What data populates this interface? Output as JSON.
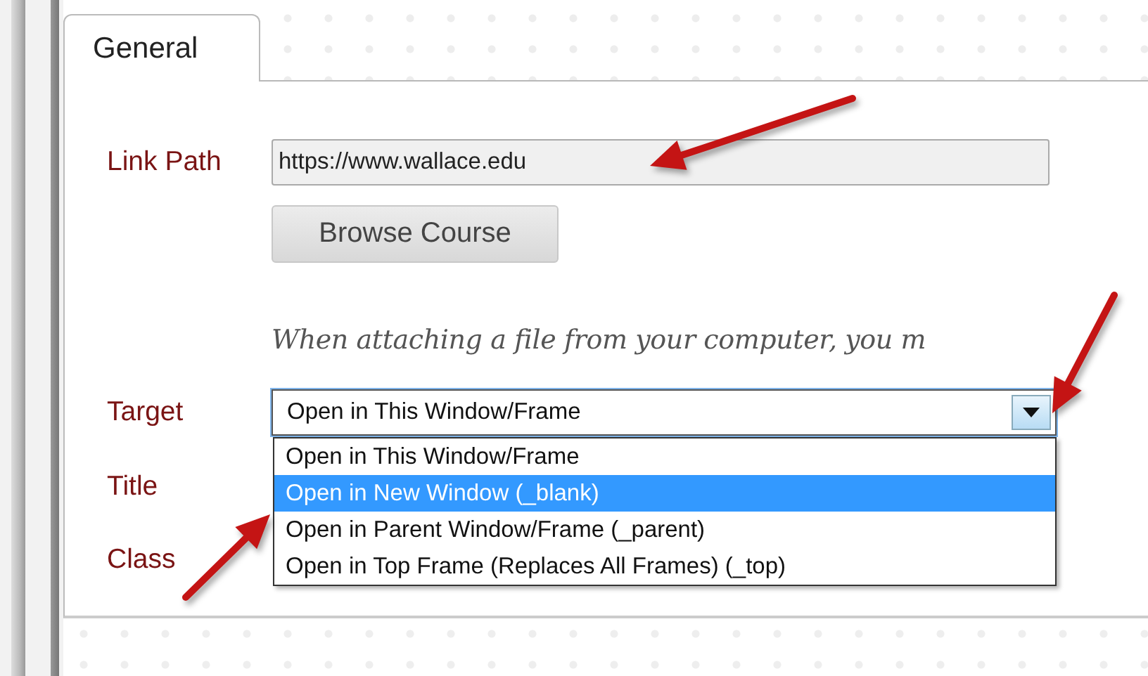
{
  "tabs": [
    {
      "label": "General",
      "selected": true
    }
  ],
  "link_path": {
    "label": "Link Path",
    "value": "https://www.wallace.edu"
  },
  "browse_button": "Browse Course",
  "note": "When attaching a file from your computer, you m",
  "target": {
    "label": "Target",
    "value": "Open in This Window/Frame",
    "expanded": true,
    "options": [
      {
        "label": "Open in This Window/Frame",
        "highlighted": false
      },
      {
        "label": "Open in New Window (_blank)",
        "highlighted": true
      },
      {
        "label": "Open in Parent Window/Frame (_parent)",
        "highlighted": false
      },
      {
        "label": "Open in Top Frame (Replaces All Frames) (_top)",
        "highlighted": false
      }
    ]
  },
  "title_field": {
    "label": "Title"
  },
  "class_field": {
    "label": "Class"
  }
}
